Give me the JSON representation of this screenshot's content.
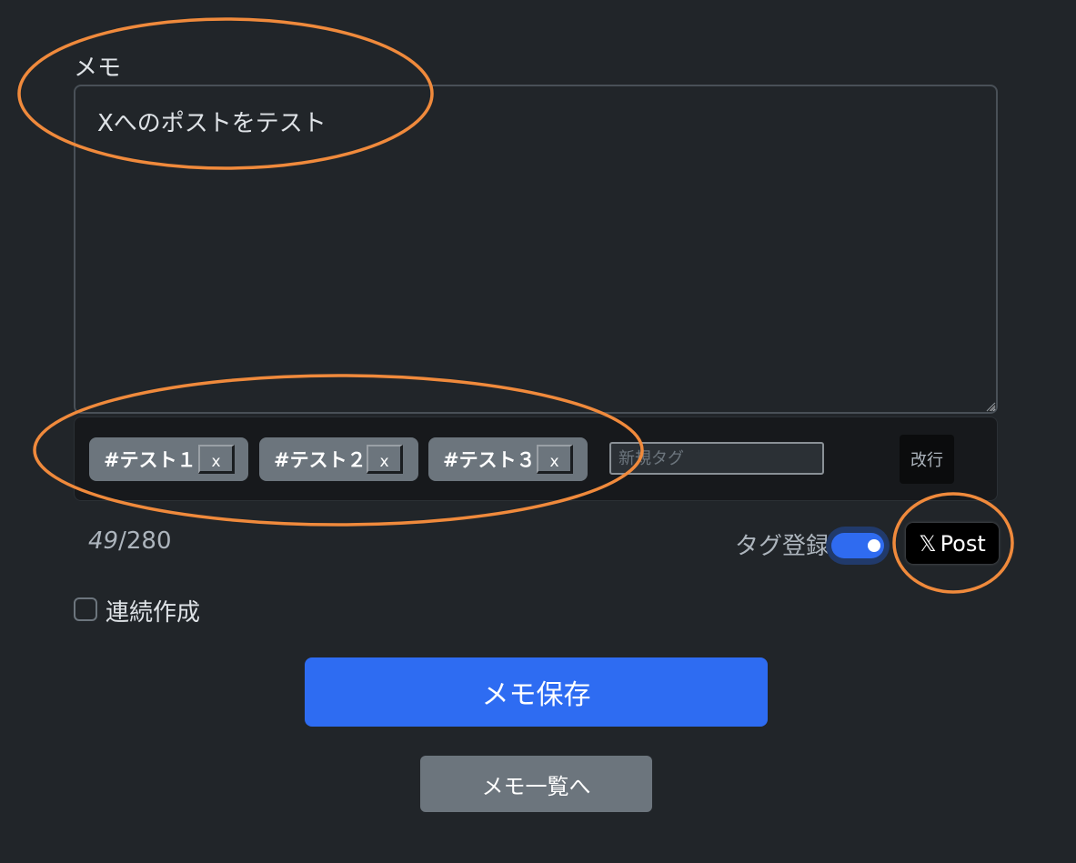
{
  "memo": {
    "label": "メモ",
    "value": "Xへのポストをテスト"
  },
  "tags": {
    "items": [
      {
        "label": "#テスト１",
        "remove_label": "x"
      },
      {
        "label": "#テスト２",
        "remove_label": "x"
      },
      {
        "label": "#テスト３",
        "remove_label": "x"
      }
    ],
    "new_tag_placeholder": "新規タグ",
    "newline_label": "改行"
  },
  "counter": {
    "current": "49",
    "separator": "/",
    "max": "280"
  },
  "tag_register": {
    "label": "タグ登録",
    "enabled": true
  },
  "x_post": {
    "logo": "𝕏",
    "label": "Post"
  },
  "continuous_create": {
    "label": "連続作成",
    "checked": false
  },
  "actions": {
    "save_label": "メモ保存",
    "list_label": "メモ一覧へ"
  },
  "colors": {
    "background": "#212529",
    "primary": "#2e6cf2",
    "secondary": "#6c757d",
    "annotation": "#f08a3c"
  }
}
